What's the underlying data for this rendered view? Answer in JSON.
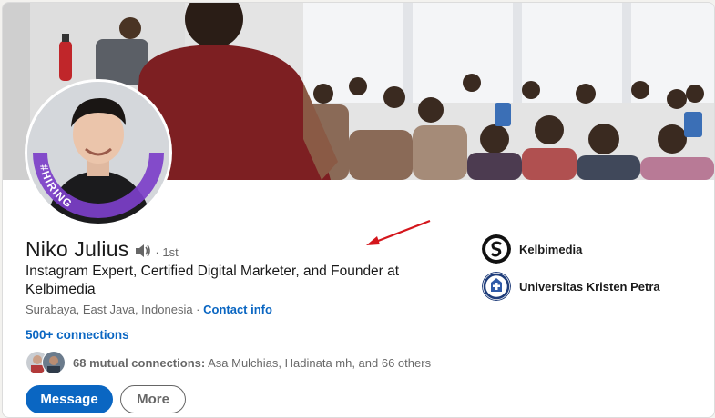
{
  "profile": {
    "name": "Niko Julius",
    "degree": "· 1st",
    "headline": "Instagram Expert, Certified Digital Marketer, and Founder at Kelbimedia",
    "location": "Surabaya, East Java, Indonesia",
    "location_sep": " · ",
    "contact_info": "Contact info",
    "connections": "500+ connections",
    "hiring_badge": "#HIRING",
    "mutual": {
      "count_label": "68 mutual connections:",
      "names": " Asa Mulchias, Hadinata mh, and 66 others"
    }
  },
  "actions": {
    "message_label": "Message",
    "more_label": "More"
  },
  "side": {
    "company": "Kelbimedia",
    "school": "Universitas Kristen Petra"
  },
  "colors": {
    "brand_blue": "#0a66c2",
    "hiring_purple": "#7c3fc9",
    "arrow_red": "#d4161c"
  },
  "icons": {
    "speaker": "speaker-icon",
    "company_logo": "kelbimedia-logo",
    "school_logo": "petra-seal-logo"
  }
}
